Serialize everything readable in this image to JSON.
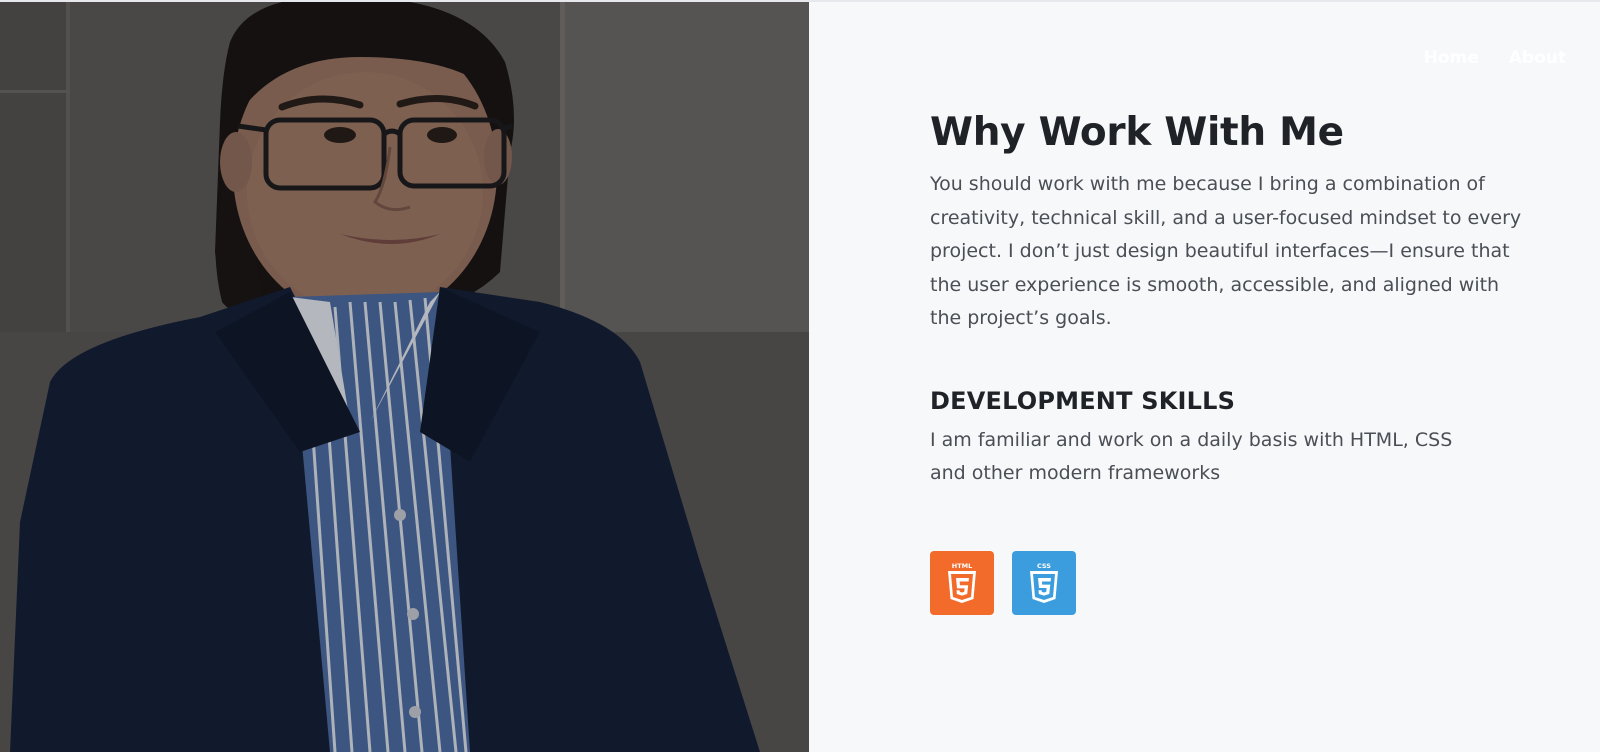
{
  "nav": {
    "items": [
      {
        "label": "Home"
      },
      {
        "label": "About"
      }
    ]
  },
  "about": {
    "title": "Why Work With Me",
    "intro": "You should work with me because I bring a combination of creativity, technical skill, and a user-focused mindset to every project. I don’t just design beautiful interfaces—I ensure that the user experience is smooth, accessible, and aligned with the project’s goals.",
    "skills_title": "DEVELOPMENT SKILLS",
    "skills_text": "I am familiar and work on a daily basis with HTML, CSS and other modern frameworks"
  },
  "tech_icons": [
    {
      "name": "html5-icon",
      "label": "HTML",
      "color": "#f26b2a"
    },
    {
      "name": "css3-icon",
      "label": "CSS",
      "color": "#3b9ddd"
    }
  ],
  "colors": {
    "background": "#f7f8fa",
    "heading": "#1f2328",
    "body_text": "#4a4f55",
    "nav_text": "#ffffff"
  }
}
